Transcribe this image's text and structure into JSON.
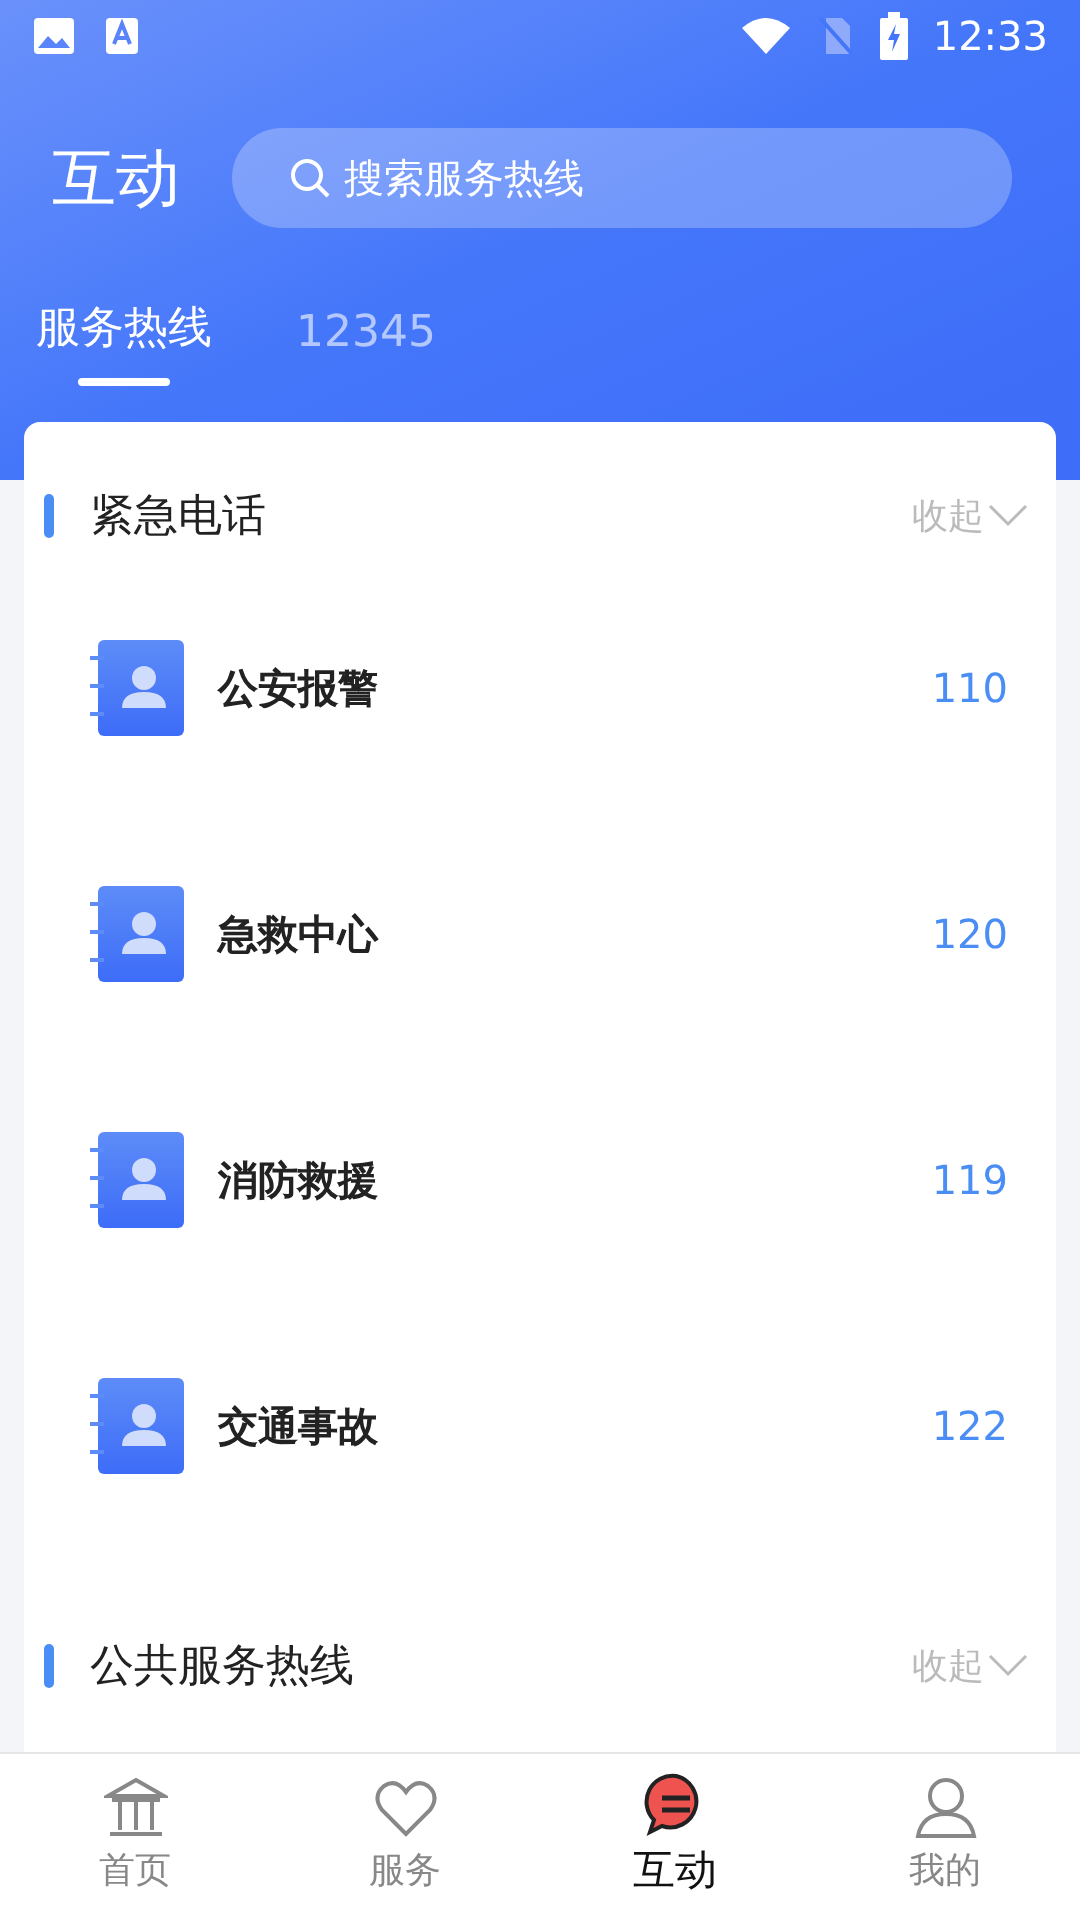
{
  "status_bar": {
    "time": "12:33"
  },
  "header": {
    "title": "互动",
    "search": {
      "placeholder": "搜索服务热线"
    }
  },
  "tabs": [
    {
      "label": "服务热线",
      "selected": true
    },
    {
      "label": "12345",
      "selected": false
    }
  ],
  "sections": [
    {
      "title": "紧急电话",
      "toggle": "收起",
      "expanded": true,
      "items": [
        {
          "name": "公安报警",
          "number": "110"
        },
        {
          "name": "急救中心",
          "number": "120"
        },
        {
          "name": "消防救援",
          "number": "119"
        },
        {
          "name": "交通事故",
          "number": "122"
        }
      ]
    },
    {
      "title": "公共服务热线",
      "toggle": "收起",
      "expanded": true
    }
  ],
  "bottom_nav": [
    {
      "label": "首页",
      "selected": false
    },
    {
      "label": "服务",
      "selected": false
    },
    {
      "label": "互动",
      "selected": true
    },
    {
      "label": "我的",
      "selected": false
    }
  ]
}
